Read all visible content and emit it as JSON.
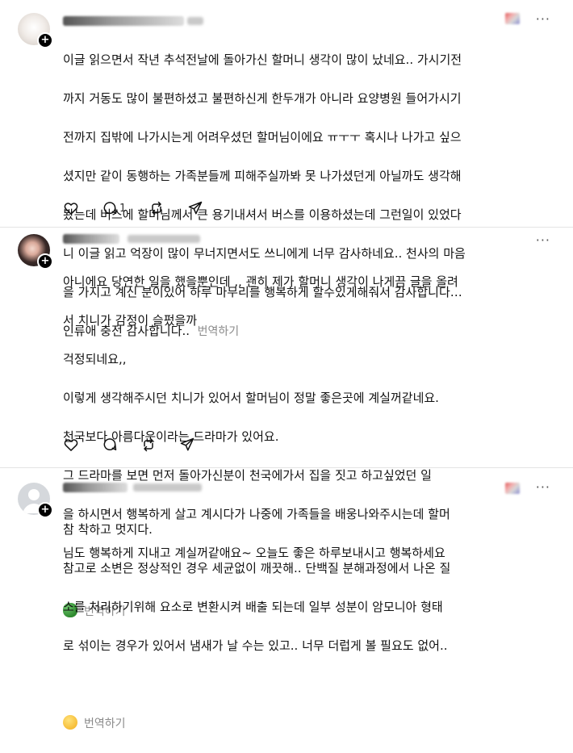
{
  "posts": [
    {
      "username": "",
      "time": "",
      "more_label": "···",
      "lines": [
        "이글 읽으면서 작년 추석전날에 돌아가신 할머니 생각이 많이 났네요.. 가시기전",
        "까지 거동도 많이 불편하셨고 불편하신게 한두개가 아니라 요양병원 들어가시기",
        "전까지 집밖에 나가시는게 어려우셨던 할머님이에요 ㅠㅜㅜ 혹시나 나가고 싶으",
        "셨지만 같이 동행하는 가족분들께 피해주실까봐 못 나가셨던게 아닐까도 생각해",
        "봤는데 버스에 할머님께서 큰 용기내셔서 버스를 이용하셨는데 그런일이 있었다",
        "니 이글 읽고 억장이 많이 무너지면서도 쓰니에게 너무 감사하네요.. 천사의 마음",
        "을 가지고 계신 분이있어 하루 마무리를 행복하게 할수있게해줘서 감사합니다…"
      ],
      "last_line": "인류애 충전 감사합니다..",
      "translate": "번역하기",
      "reply_count": "1",
      "avatar_color": "#e9e4df"
    },
    {
      "username": "",
      "time": "",
      "more_label": "···",
      "lines": [
        "아니에요 당연한 일을 했을뿐인데 ,, 괜히 제가 할머니 생각이 나게끔 글을 올려",
        "서 치니가 감정이 슬펐을까",
        "걱정되네요,,",
        "이렇게 생각해주시던 치니가 있어서 할머님이 정말 좋은곳에 계실꺼같네요.",
        "천국보다 아름다운이라는 드라마가 있어요.",
        "그 드라마를 보면 먼저 돌아가신분이 천국에가서 집을 짓고 하고싶었던 일",
        "을 하시면서 행복하게 살고 계시다가 나중에 가족들을 배웅나와주시는데 할머",
        "님도 행복하게 지내고 계실꺼같애요~ 오늘도 좋은 하루보내시고 행복하세요"
      ],
      "last_line": "",
      "translate": "번역하기",
      "reply_count": "",
      "avatar_color": "#2b2b2b"
    },
    {
      "username": "",
      "time": "",
      "more_label": "···",
      "lines": [
        "참 착하고 멋지다.",
        "참고로 소변은 정상적인 경우 세균없이 깨끗해.. 단백질 분해과정에서 나온 질",
        "소를 처리하기위해 요소로 변환시켜 배출 되는데 일부 성분이 암모니아 형태",
        "로 섞이는 경우가 있어서 냄새가 날 수는 있고.. 너무 더럽게 볼 필요도 없어.."
      ],
      "last_line": "",
      "translate": "번역하기",
      "reply_count": "",
      "avatar_color": "#d5d8dc"
    }
  ],
  "icons": [
    "heart-icon",
    "comment-icon",
    "repost-icon",
    "share-icon",
    "clover-emoji",
    "smile-emoji"
  ]
}
